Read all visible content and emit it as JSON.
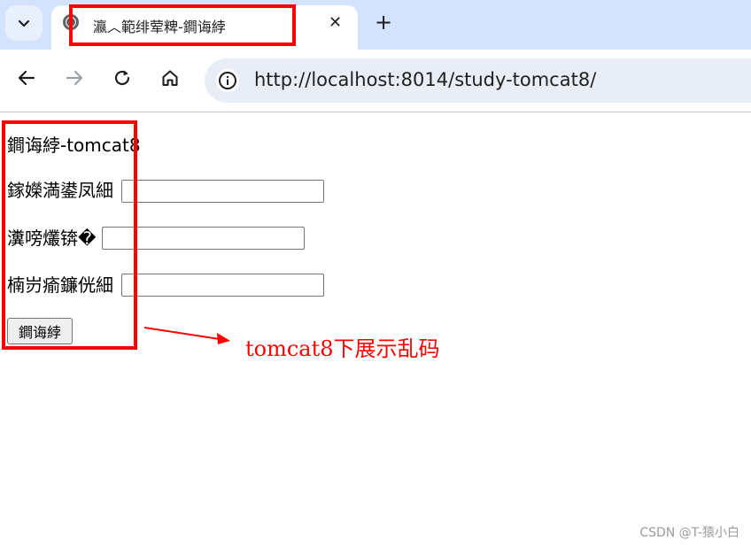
{
  "browser": {
    "tab": {
      "title": "瀛︿範绯荤粺-鐧诲綍",
      "close_glyph": "✕"
    },
    "new_tab_glyph": "+",
    "tab_list_glyph": "⌄",
    "address_bar": {
      "url": "http://localhost:8014/study-tomcat8/"
    },
    "icons": [
      "tab-list-icon",
      "globe-icon",
      "close-icon",
      "plus-icon",
      "back-arrow-icon",
      "forward-arrow-icon",
      "reload-icon",
      "home-icon",
      "info-icon"
    ]
  },
  "page": {
    "heading": "鐧诲綍-tomcat8",
    "fields": [
      {
        "label": "鎵嬫満鍙凤細"
      },
      {
        "label": "瀵嗙爜锛�"
      },
      {
        "label": "楠岃瘉鐮侊細"
      }
    ],
    "submit_label": "鐧诲綍"
  },
  "annotation": {
    "text": "tomcat8下展示乱码",
    "color": "#ff0000"
  },
  "watermark": "CSDN @T-猿小白",
  "colors": {
    "tabstrip": "#d3e3fd",
    "omnibox": "#e9eef6",
    "highlight": "#ff0000"
  }
}
